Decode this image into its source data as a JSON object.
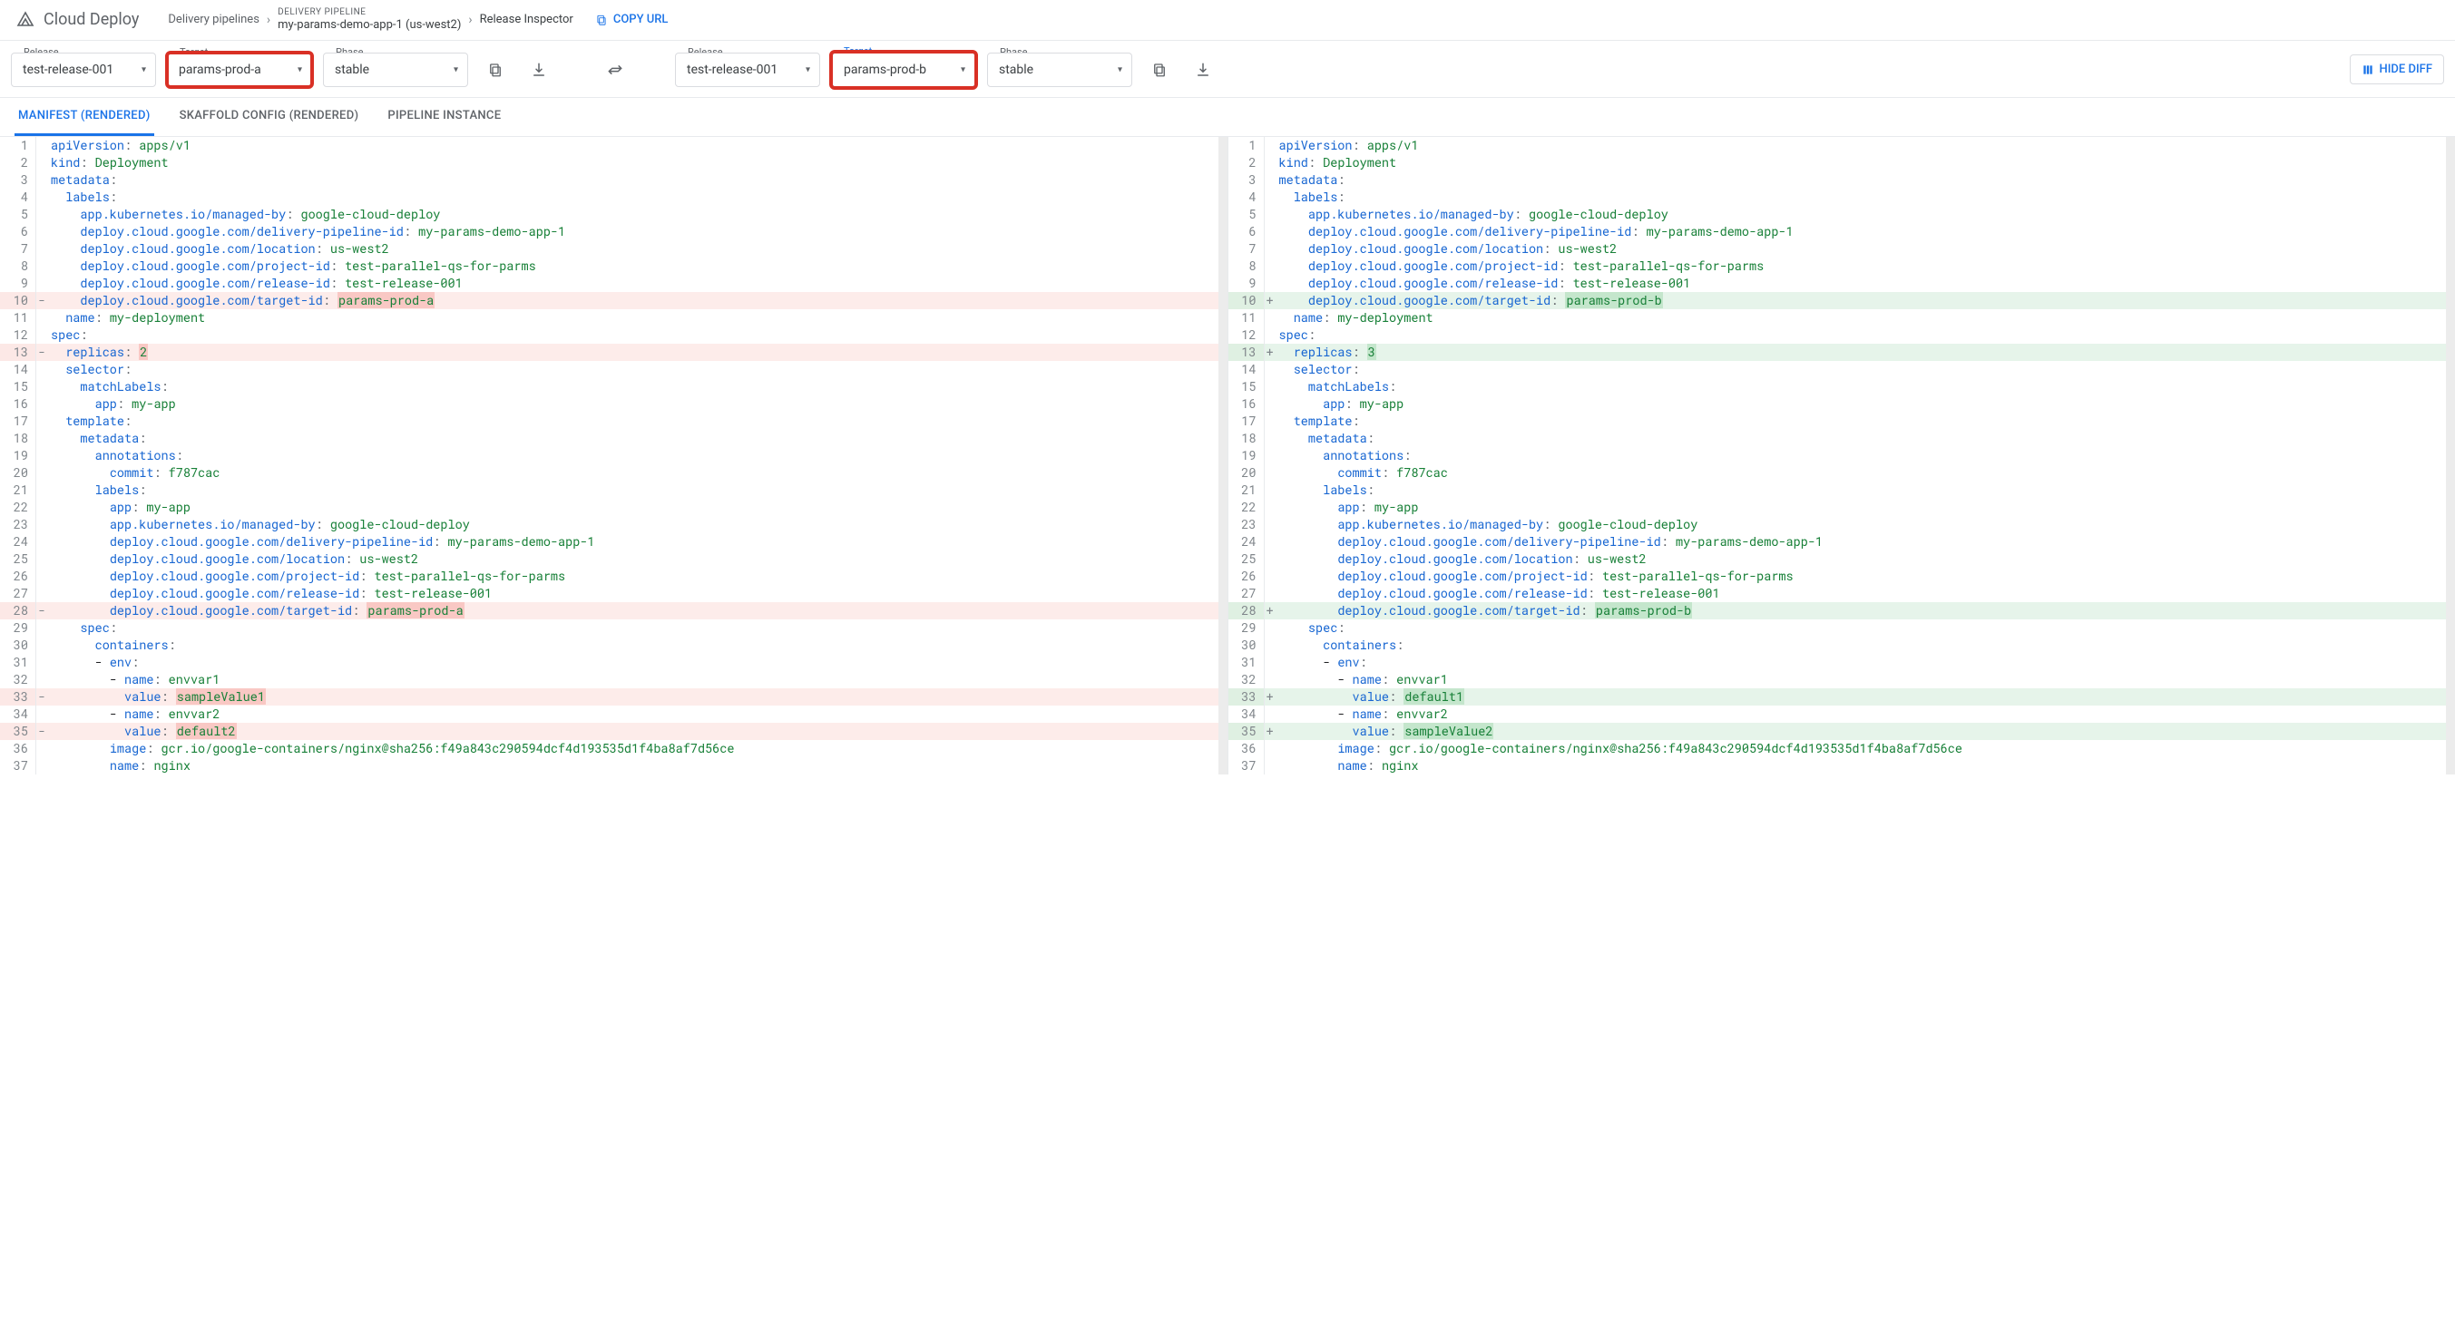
{
  "app": {
    "name": "Cloud Deploy"
  },
  "breadcrumb": {
    "root": "Delivery pipelines",
    "pipeline_label": "DELIVERY PIPELINE",
    "pipeline_name": "my-params-demo-app-1 (us-west2)",
    "page": "Release Inspector",
    "copy_url": "COPY URL"
  },
  "left": {
    "release_label": "Release",
    "release": "test-release-001",
    "target_label": "Target",
    "target": "params-prod-a",
    "phase_label": "Phase",
    "phase": "stable"
  },
  "right": {
    "release_label": "Release",
    "release": "test-release-001",
    "target_label": "Target",
    "target": "params-prod-b",
    "phase_label": "Phase",
    "phase": "stable"
  },
  "hide_diff": "HIDE DIFF",
  "tabs": {
    "manifest": "MANIFEST (RENDERED)",
    "skaffold": "SKAFFOLD CONFIG (RENDERED)",
    "pipeline": "PIPELINE INSTANCE"
  },
  "manifest_left": {
    "lines": [
      {
        "n": 1,
        "k": "apiVersion",
        "v": "apps/v1"
      },
      {
        "n": 2,
        "k": "kind",
        "v": "Deployment"
      },
      {
        "n": 3,
        "k": "metadata",
        "v": ""
      },
      {
        "n": 4,
        "indent": 1,
        "k": "labels",
        "v": ""
      },
      {
        "n": 5,
        "indent": 2,
        "k": "app.kubernetes.io/managed-by",
        "v": "google-cloud-deploy"
      },
      {
        "n": 6,
        "indent": 2,
        "k": "deploy.cloud.google.com/delivery-pipeline-id",
        "v": "my-params-demo-app-1"
      },
      {
        "n": 7,
        "indent": 2,
        "k": "deploy.cloud.google.com/location",
        "v": "us-west2"
      },
      {
        "n": 8,
        "indent": 2,
        "k": "deploy.cloud.google.com/project-id",
        "v": "test-parallel-qs-for-parms"
      },
      {
        "n": 9,
        "indent": 2,
        "k": "deploy.cloud.google.com/release-id",
        "v": "test-release-001"
      },
      {
        "n": 10,
        "indent": 2,
        "k": "deploy.cloud.google.com/target-id",
        "v": "params-prod-a",
        "diff": "del",
        "inline": true
      },
      {
        "n": 11,
        "indent": 1,
        "k": "name",
        "v": "my-deployment"
      },
      {
        "n": 12,
        "k": "spec",
        "v": ""
      },
      {
        "n": 13,
        "indent": 1,
        "k": "replicas",
        "v": "2",
        "diff": "del",
        "inline": true
      },
      {
        "n": 14,
        "indent": 1,
        "k": "selector",
        "v": ""
      },
      {
        "n": 15,
        "indent": 2,
        "k": "matchLabels",
        "v": ""
      },
      {
        "n": 16,
        "indent": 3,
        "k": "app",
        "v": "my-app"
      },
      {
        "n": 17,
        "indent": 1,
        "k": "template",
        "v": ""
      },
      {
        "n": 18,
        "indent": 2,
        "k": "metadata",
        "v": ""
      },
      {
        "n": 19,
        "indent": 3,
        "k": "annotations",
        "v": ""
      },
      {
        "n": 20,
        "indent": 4,
        "k": "commit",
        "v": "f787cac"
      },
      {
        "n": 21,
        "indent": 3,
        "k": "labels",
        "v": ""
      },
      {
        "n": 22,
        "indent": 4,
        "k": "app",
        "v": "my-app"
      },
      {
        "n": 23,
        "indent": 4,
        "k": "app.kubernetes.io/managed-by",
        "v": "google-cloud-deploy"
      },
      {
        "n": 24,
        "indent": 4,
        "k": "deploy.cloud.google.com/delivery-pipeline-id",
        "v": "my-params-demo-app-1"
      },
      {
        "n": 25,
        "indent": 4,
        "k": "deploy.cloud.google.com/location",
        "v": "us-west2"
      },
      {
        "n": 26,
        "indent": 4,
        "k": "deploy.cloud.google.com/project-id",
        "v": "test-parallel-qs-for-parms"
      },
      {
        "n": 27,
        "indent": 4,
        "k": "deploy.cloud.google.com/release-id",
        "v": "test-release-001"
      },
      {
        "n": 28,
        "indent": 4,
        "k": "deploy.cloud.google.com/target-id",
        "v": "params-prod-a",
        "diff": "del",
        "inline": true
      },
      {
        "n": 29,
        "indent": 2,
        "k": "spec",
        "v": ""
      },
      {
        "n": 30,
        "indent": 3,
        "k": "containers",
        "v": ""
      },
      {
        "n": 31,
        "indent": 3,
        "dash": true,
        "k": "env",
        "v": ""
      },
      {
        "n": 32,
        "indent": 4,
        "dash": true,
        "k": "name",
        "v": "envvar1"
      },
      {
        "n": 33,
        "indent": 5,
        "k": "value",
        "v": "sampleValue1",
        "diff": "del",
        "inline": true
      },
      {
        "n": 34,
        "indent": 4,
        "dash": true,
        "k": "name",
        "v": "envvar2"
      },
      {
        "n": 35,
        "indent": 5,
        "k": "value",
        "v": "default2",
        "diff": "del",
        "inline": true
      },
      {
        "n": 36,
        "indent": 4,
        "k": "image",
        "v": "gcr.io/google-containers/nginx@sha256:f49a843c290594dcf4d193535d1f4ba8af7d56ce"
      },
      {
        "n": 37,
        "indent": 4,
        "k": "name",
        "v": "nginx"
      }
    ]
  },
  "manifest_right": {
    "lines": [
      {
        "n": 1,
        "k": "apiVersion",
        "v": "apps/v1"
      },
      {
        "n": 2,
        "k": "kind",
        "v": "Deployment"
      },
      {
        "n": 3,
        "k": "metadata",
        "v": ""
      },
      {
        "n": 4,
        "indent": 1,
        "k": "labels",
        "v": ""
      },
      {
        "n": 5,
        "indent": 2,
        "k": "app.kubernetes.io/managed-by",
        "v": "google-cloud-deploy"
      },
      {
        "n": 6,
        "indent": 2,
        "k": "deploy.cloud.google.com/delivery-pipeline-id",
        "v": "my-params-demo-app-1"
      },
      {
        "n": 7,
        "indent": 2,
        "k": "deploy.cloud.google.com/location",
        "v": "us-west2"
      },
      {
        "n": 8,
        "indent": 2,
        "k": "deploy.cloud.google.com/project-id",
        "v": "test-parallel-qs-for-parms"
      },
      {
        "n": 9,
        "indent": 2,
        "k": "deploy.cloud.google.com/release-id",
        "v": "test-release-001"
      },
      {
        "n": 10,
        "indent": 2,
        "k": "deploy.cloud.google.com/target-id",
        "v": "params-prod-b",
        "diff": "add",
        "inline": true
      },
      {
        "n": 11,
        "indent": 1,
        "k": "name",
        "v": "my-deployment"
      },
      {
        "n": 12,
        "k": "spec",
        "v": ""
      },
      {
        "n": 13,
        "indent": 1,
        "k": "replicas",
        "v": "3",
        "diff": "add",
        "inline": true
      },
      {
        "n": 14,
        "indent": 1,
        "k": "selector",
        "v": ""
      },
      {
        "n": 15,
        "indent": 2,
        "k": "matchLabels",
        "v": ""
      },
      {
        "n": 16,
        "indent": 3,
        "k": "app",
        "v": "my-app"
      },
      {
        "n": 17,
        "indent": 1,
        "k": "template",
        "v": ""
      },
      {
        "n": 18,
        "indent": 2,
        "k": "metadata",
        "v": ""
      },
      {
        "n": 19,
        "indent": 3,
        "k": "annotations",
        "v": ""
      },
      {
        "n": 20,
        "indent": 4,
        "k": "commit",
        "v": "f787cac"
      },
      {
        "n": 21,
        "indent": 3,
        "k": "labels",
        "v": ""
      },
      {
        "n": 22,
        "indent": 4,
        "k": "app",
        "v": "my-app"
      },
      {
        "n": 23,
        "indent": 4,
        "k": "app.kubernetes.io/managed-by",
        "v": "google-cloud-deploy"
      },
      {
        "n": 24,
        "indent": 4,
        "k": "deploy.cloud.google.com/delivery-pipeline-id",
        "v": "my-params-demo-app-1"
      },
      {
        "n": 25,
        "indent": 4,
        "k": "deploy.cloud.google.com/location",
        "v": "us-west2"
      },
      {
        "n": 26,
        "indent": 4,
        "k": "deploy.cloud.google.com/project-id",
        "v": "test-parallel-qs-for-parms"
      },
      {
        "n": 27,
        "indent": 4,
        "k": "deploy.cloud.google.com/release-id",
        "v": "test-release-001"
      },
      {
        "n": 28,
        "indent": 4,
        "k": "deploy.cloud.google.com/target-id",
        "v": "params-prod-b",
        "diff": "add",
        "inline": true
      },
      {
        "n": 29,
        "indent": 2,
        "k": "spec",
        "v": ""
      },
      {
        "n": 30,
        "indent": 3,
        "k": "containers",
        "v": ""
      },
      {
        "n": 31,
        "indent": 3,
        "dash": true,
        "k": "env",
        "v": ""
      },
      {
        "n": 32,
        "indent": 4,
        "dash": true,
        "k": "name",
        "v": "envvar1"
      },
      {
        "n": 33,
        "indent": 5,
        "k": "value",
        "v": "default1",
        "diff": "add",
        "inline": true
      },
      {
        "n": 34,
        "indent": 4,
        "dash": true,
        "k": "name",
        "v": "envvar2"
      },
      {
        "n": 35,
        "indent": 5,
        "k": "value",
        "v": "sampleValue2",
        "diff": "add",
        "inline": true
      },
      {
        "n": 36,
        "indent": 4,
        "k": "image",
        "v": "gcr.io/google-containers/nginx@sha256:f49a843c290594dcf4d193535d1f4ba8af7d56ce"
      },
      {
        "n": 37,
        "indent": 4,
        "k": "name",
        "v": "nginx"
      }
    ]
  }
}
